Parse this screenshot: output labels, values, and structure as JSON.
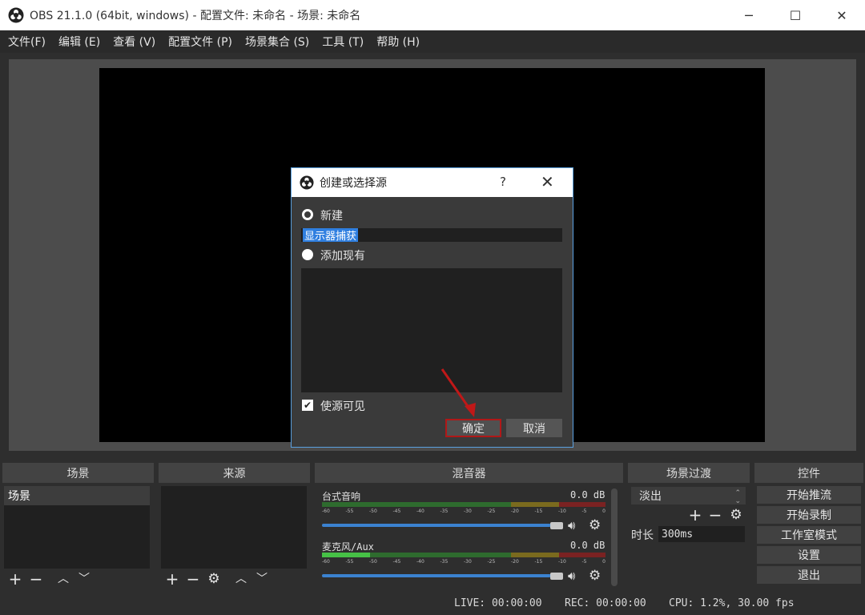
{
  "window": {
    "title": "OBS 21.1.0 (64bit, windows) - 配置文件: 未命名 - 场景: 未命名",
    "minimize": "─",
    "maximize": "☐",
    "close": "✕"
  },
  "menu": [
    {
      "label": "文件(F)"
    },
    {
      "label": "编辑 (E)"
    },
    {
      "label": "查看 (V)"
    },
    {
      "label": "配置文件 (P)"
    },
    {
      "label": "场景集合 (S)"
    },
    {
      "label": "工具 (T)"
    },
    {
      "label": "帮助 (H)"
    }
  ],
  "docks": {
    "scenes": {
      "title": "场景",
      "items": [
        "场景"
      ]
    },
    "sources": {
      "title": "来源"
    },
    "mixer": {
      "title": "混音器",
      "tracks": [
        {
          "name": "台式音响",
          "db": "0.0 dB",
          "level": 0
        },
        {
          "name": "麦克风/Aux",
          "db": "0.0 dB",
          "level": 0.12
        }
      ],
      "ticks": [
        "-60",
        "-55",
        "-50",
        "-45",
        "-40",
        "-35",
        "-30",
        "-25",
        "-20",
        "-15",
        "-10",
        "-5",
        "0"
      ]
    },
    "transitions": {
      "title": "场景过渡",
      "selected": "淡出",
      "duration_label": "时长",
      "duration": "300ms"
    },
    "controls": {
      "title": "控件",
      "buttons": [
        "开始推流",
        "开始录制",
        "工作室模式",
        "设置",
        "退出"
      ]
    }
  },
  "status": {
    "live": "LIVE: 00:00:00",
    "rec": "REC: 00:00:00",
    "cpu": "CPU: 1.2%, 30.00 fps"
  },
  "dialog": {
    "title": "创建或选择源",
    "help": "?",
    "close": "✕",
    "option_new": "新建",
    "name_value": "显示器捕获",
    "option_existing": "添加现有",
    "visible_label": "使源可见",
    "visible_checked": true,
    "ok": "确定",
    "cancel": "取消"
  },
  "colors": {
    "accent": "#2f7fe0",
    "highlight": "#b01818",
    "annotation_arrow": "#c01818"
  }
}
